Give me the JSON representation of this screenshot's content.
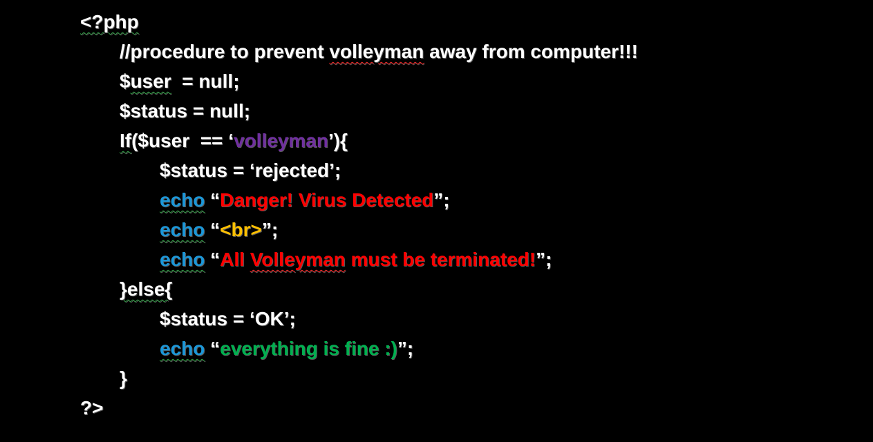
{
  "code": {
    "l1": "<?php",
    "l2a": "//procedure to prevent ",
    "l2b": "volleyman",
    "l2c": " away from computer!!!",
    "l3a": "$",
    "l3b": "user",
    "l3c": "  = null;",
    "l4": "$status = null;",
    "l5a": "If",
    "l5b": "($user  == ‘",
    "l5c": "volleyman",
    "l5d": "’){",
    "l6": "$status = ‘rejected’;",
    "l7kw": "echo",
    "l7a": " “",
    "l7b": "Danger! Virus Detected",
    "l7c": "”;",
    "l8kw": "echo",
    "l8a": " “",
    "l8b": "<br>",
    "l8c": "”;",
    "l9kw": "echo",
    "l9a": " “",
    "l9b": "All ",
    "l9c": "Volleyman",
    "l9d": " must be terminated!",
    "l9e": "”;",
    "l10": "}else{",
    "l11": "$status = ‘OK’;",
    "l12kw": "echo",
    "l12a": " “",
    "l12b": "everything is fine :)",
    "l12c": "”;",
    "l13": "}",
    "l14": "?>"
  },
  "colors": {
    "background": "#000000",
    "text": "#ffffff",
    "keyword": "#1c97d8",
    "string_danger": "#ff0000",
    "string_name": "#7030a0",
    "string_tag": "#ffc000",
    "string_ok": "#00b050",
    "spellcheck_red": "#ff2a2a",
    "spellcheck_green": "#2ea043"
  }
}
